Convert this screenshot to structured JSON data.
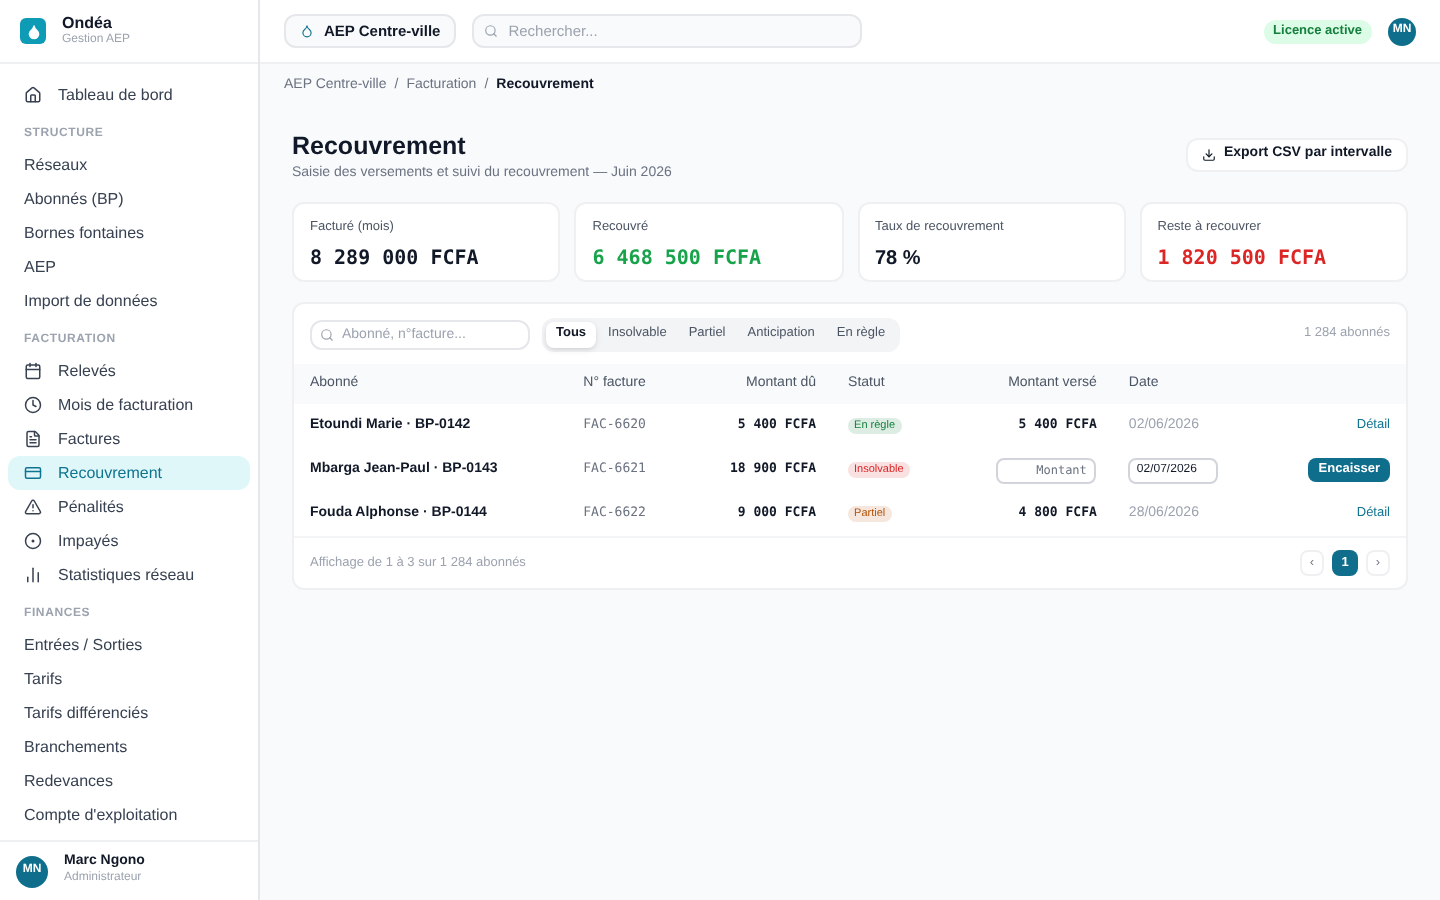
{
  "brand": {
    "name": "Ondéa",
    "subtitle": "Gestion AEP"
  },
  "sidebar": {
    "top": [
      {
        "label": "Tableau de bord",
        "selected": false
      }
    ],
    "sections": [
      {
        "title": "STRUCTURE",
        "items": [
          {
            "label": "Réseaux",
            "selected": false
          },
          {
            "label": "Abonnés (BP)",
            "selected": false
          },
          {
            "label": "Bornes fontaines",
            "selected": false
          },
          {
            "label": "AEP",
            "selected": false
          },
          {
            "label": "Import de données",
            "selected": false
          }
        ]
      },
      {
        "title": "FACTURATION",
        "items": [
          {
            "label": "Relevés",
            "selected": false
          },
          {
            "label": "Mois de facturation",
            "selected": false
          },
          {
            "label": "Factures",
            "selected": false
          },
          {
            "label": "Recouvrement",
            "selected": true
          },
          {
            "label": "Pénalités",
            "selected": false
          },
          {
            "label": "Impayés",
            "selected": false
          },
          {
            "label": "Statistiques réseau",
            "selected": false
          }
        ]
      },
      {
        "title": "FINANCES",
        "items": [
          {
            "label": "Entrées / Sorties",
            "selected": false
          },
          {
            "label": "Tarifs",
            "selected": false
          },
          {
            "label": "Tarifs différenciés",
            "selected": false
          },
          {
            "label": "Branchements",
            "selected": false
          },
          {
            "label": "Redevances",
            "selected": false
          },
          {
            "label": "Compte d'exploitation",
            "selected": false
          }
        ]
      }
    ],
    "user": {
      "initials": "MN",
      "name": "Marc Ngono",
      "role": "Administrateur"
    }
  },
  "topbar": {
    "site": "AEP Centre-ville",
    "search": {
      "placeholder": "Rechercher..."
    },
    "licence": "Licence active",
    "avatar": "MN"
  },
  "breadcrumb": {
    "separator": "/",
    "items": [
      "AEP Centre-ville",
      "Facturation",
      "Recouvrement"
    ]
  },
  "page": {
    "title": "Recouvrement",
    "subtitle": "Saisie des versements et suivi du recouvrement — Juin 2026",
    "export": "Export CSV par intervalle"
  },
  "stats": [
    {
      "label": "Facturé (mois)",
      "value": "8 289 000 FCFA",
      "color": "#111827",
      "mono": true
    },
    {
      "label": "Recouvré",
      "value": "6 468 500 FCFA",
      "color": "#16a34a",
      "mono": true
    },
    {
      "label": "Taux de recouvrement",
      "value": "78 %",
      "color": "#111827",
      "mono": false
    },
    {
      "label": "Reste à recouvrer",
      "value": "1 820 500 FCFA",
      "color": "#dc2626",
      "mono": true
    }
  ],
  "table": {
    "search": {
      "placeholder": "Abonné, n°facture..."
    },
    "filters": [
      {
        "label": "Tous",
        "selected": true
      },
      {
        "label": "Insolvable",
        "selected": false
      },
      {
        "label": "Partiel",
        "selected": false
      },
      {
        "label": "Anticipation",
        "selected": false
      },
      {
        "label": "En règle",
        "selected": false
      }
    ],
    "count": "1 284 abonnés",
    "columns": [
      "Abonné",
      "N° facture",
      "Montant dû",
      "Statut",
      "Montant versé",
      "Date"
    ],
    "rows": [
      {
        "kind": "paid",
        "subscriber": "Etoundi Marie · BP-0142",
        "invoice": "FAC-6620",
        "due": "5 400 FCFA",
        "status": "En règle",
        "color": "#15803d",
        "paid": "5 400 FCFA",
        "date": "02/06/2026",
        "action": "Détail"
      },
      {
        "kind": "entry",
        "subscriber": "Mbarga Jean-Paul · BP-0143",
        "invoice": "FAC-6621",
        "due": "18 900 FCFA",
        "status": "Insolvable",
        "color": "#dc2626",
        "amount_placeholder": "Montant",
        "date": "02/07/2026",
        "action": "Encaisser"
      },
      {
        "kind": "paid",
        "subscriber": "Fouda Alphonse · BP-0144",
        "invoice": "FAC-6622",
        "due": "9 000 FCFA",
        "status": "Partiel",
        "color": "#b45309",
        "paid": "4 800 FCFA",
        "date": "28/06/2026",
        "action": "Détail"
      }
    ],
    "footer": "Affichage de 1 à 3 sur 1 284 abonnés",
    "pages": [
      {
        "label": "‹",
        "kind": "prev",
        "selected": false
      },
      {
        "label": "1",
        "kind": "page",
        "selected": true
      },
      {
        "label": "›",
        "kind": "next",
        "selected": false
      }
    ]
  }
}
